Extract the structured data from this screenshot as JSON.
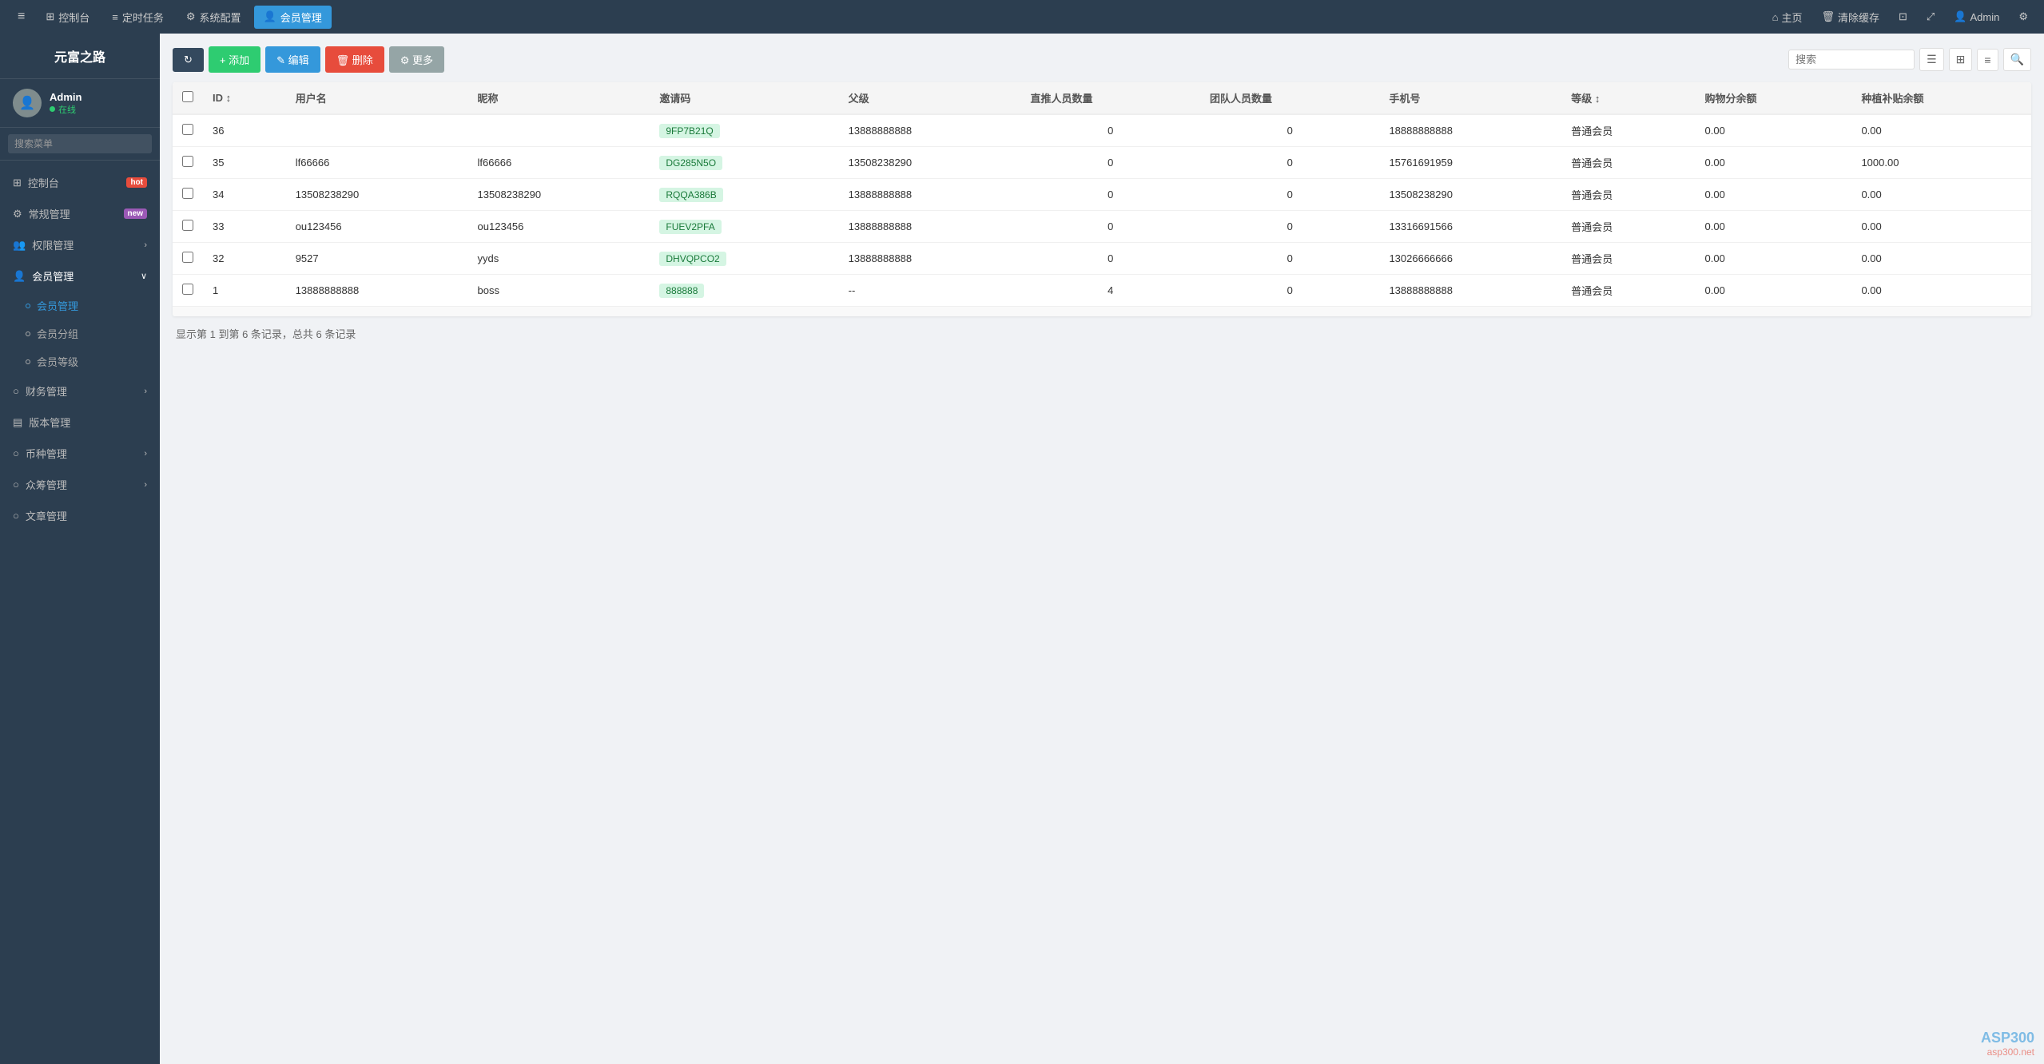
{
  "app": {
    "logo": "元富之路"
  },
  "topnav": {
    "hamburger": "≡",
    "items": [
      {
        "id": "dashboard",
        "icon": "⊞",
        "label": "控制台",
        "active": false
      },
      {
        "id": "schedule",
        "icon": "≡",
        "label": "定时任务",
        "active": false
      },
      {
        "id": "sysconfig",
        "icon": "⚙",
        "label": "系统配置",
        "active": false
      },
      {
        "id": "member",
        "icon": "👤",
        "label": "会员管理",
        "active": true
      }
    ],
    "right": [
      {
        "id": "home",
        "icon": "⌂",
        "label": "主页"
      },
      {
        "id": "clear-cache",
        "icon": "🗑",
        "label": "清除缓存"
      },
      {
        "id": "icon1",
        "icon": "⊡",
        "label": ""
      },
      {
        "id": "fullscreen",
        "icon": "✕",
        "label": ""
      },
      {
        "id": "admin",
        "icon": "👤",
        "label": "Admin"
      },
      {
        "id": "settings",
        "icon": "⚙",
        "label": ""
      }
    ]
  },
  "sidebar": {
    "user": {
      "name": "Admin",
      "status": "在线"
    },
    "search_placeholder": "搜索菜单",
    "menu": [
      {
        "id": "dashboard",
        "icon": "⊞",
        "label": "控制台",
        "badge": "hot",
        "badge_type": "hot",
        "has_sub": false
      },
      {
        "id": "general",
        "icon": "⚙",
        "label": "常规管理",
        "badge": "new",
        "badge_type": "new",
        "has_sub": false
      },
      {
        "id": "permission",
        "icon": "👥",
        "label": "权限管理",
        "chevron": "‹",
        "has_sub": false
      },
      {
        "id": "member-mgmt",
        "icon": "👤",
        "label": "会员管理",
        "chevron": "∨",
        "has_sub": true,
        "expanded": true
      },
      {
        "id": "finance",
        "icon": "○",
        "label": "财务管理",
        "chevron": "‹",
        "has_sub": false
      },
      {
        "id": "version",
        "icon": "▤",
        "label": "版本管理",
        "has_sub": false
      },
      {
        "id": "currency",
        "icon": "○",
        "label": "币种管理",
        "chevron": "‹",
        "has_sub": false
      },
      {
        "id": "crowdfund",
        "icon": "○",
        "label": "众筹管理",
        "chevron": "‹",
        "has_sub": false
      },
      {
        "id": "article",
        "icon": "○",
        "label": "文章管理",
        "has_sub": false
      }
    ],
    "submenu": [
      {
        "id": "member-list",
        "label": "会员管理",
        "active": true
      },
      {
        "id": "member-group",
        "label": "会员分组",
        "active": false
      },
      {
        "id": "member-level",
        "label": "会员等级",
        "active": false
      }
    ]
  },
  "toolbar": {
    "refresh_label": "↻",
    "add_label": "+ 添加",
    "edit_label": "✎ 编辑",
    "delete_label": "🗑 删除",
    "more_label": "⚙ 更多",
    "search_placeholder": "搜索"
  },
  "table": {
    "columns": [
      "ID",
      "用户名",
      "昵称",
      "邀请码",
      "父级",
      "直推人员数量",
      "团队人员数量",
      "手机号",
      "等级",
      "购物分余额",
      "种植补贴余额"
    ],
    "rows": [
      {
        "id": "36",
        "username": "",
        "nickname": "",
        "invite_code": "9FP7B21Q",
        "parent": "13888888888",
        "direct": "0",
        "team": "0",
        "phone": "18888888888",
        "level": "普通会员",
        "shop_balance": "0.00",
        "plant_balance": "0.00"
      },
      {
        "id": "35",
        "username": "lf66666",
        "nickname": "lf66666",
        "invite_code": "DG285N5O",
        "parent": "13508238290",
        "direct": "0",
        "team": "0",
        "phone": "15761691959",
        "level": "普通会员",
        "shop_balance": "0.00",
        "plant_balance": "1000.00"
      },
      {
        "id": "34",
        "username": "13508238290",
        "nickname": "13508238290",
        "invite_code": "RQQA386B",
        "parent": "13888888888",
        "direct": "0",
        "team": "0",
        "phone": "13508238290",
        "level": "普通会员",
        "shop_balance": "0.00",
        "plant_balance": "0.00"
      },
      {
        "id": "33",
        "username": "ou123456",
        "nickname": "ou123456",
        "invite_code": "FUEV2PFA",
        "parent": "13888888888",
        "direct": "0",
        "team": "0",
        "phone": "13316691566",
        "level": "普通会员",
        "shop_balance": "0.00",
        "plant_balance": "0.00"
      },
      {
        "id": "32",
        "username": "9527",
        "nickname": "yyds",
        "invite_code": "DHVQPCO2",
        "parent": "13888888888",
        "direct": "0",
        "team": "0",
        "phone": "13026666666",
        "level": "普通会员",
        "shop_balance": "0.00",
        "plant_balance": "0.00"
      },
      {
        "id": "1",
        "username": "13888888888",
        "nickname": "boss",
        "invite_code": "888888",
        "parent": "--",
        "direct": "4",
        "team": "0",
        "phone": "13888888888",
        "level": "普通会员",
        "shop_balance": "0.00",
        "plant_balance": "0.00"
      }
    ]
  },
  "pagination": {
    "info": "显示第 1 到第 6 条记录，总共 6 条记录"
  },
  "watermark": {
    "line1": "ASP300",
    "line2": "asp300.net"
  }
}
